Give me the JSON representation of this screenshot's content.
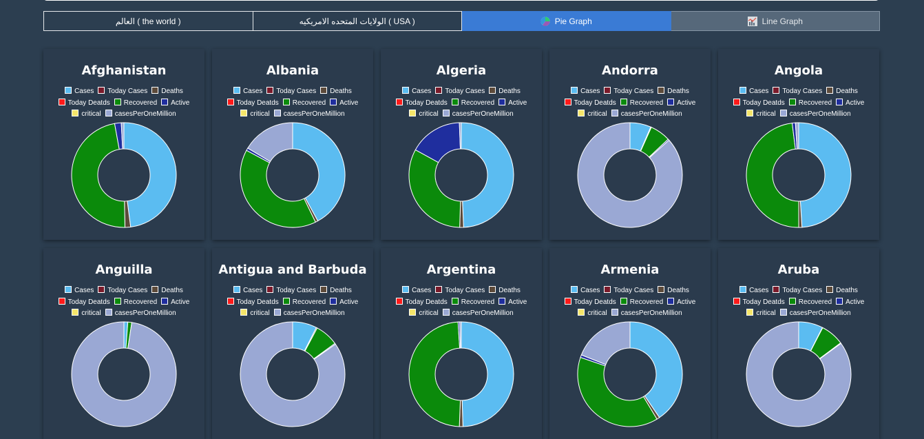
{
  "tabs": [
    {
      "label": "العالم ( the world )",
      "icon": "",
      "state": "default"
    },
    {
      "label": "الولايات المتحده الامريكيه ( USA )",
      "icon": "",
      "state": "default"
    },
    {
      "label": "Pie Graph",
      "icon": "pie-chart-icon",
      "state": "active"
    },
    {
      "label": "Line Graph",
      "icon": "line-chart-icon",
      "state": "muted"
    }
  ],
  "legend": [
    {
      "label": "Cases",
      "color": "#5bbcf1"
    },
    {
      "label": "Today Cases",
      "color": "#7a1a2a"
    },
    {
      "label": "Deaths",
      "color": "#5c4a3a"
    },
    {
      "label": "Today Deatds",
      "color": "#ff1a1a"
    },
    {
      "label": "Recovered",
      "color": "#0b8a0b"
    },
    {
      "label": "Active",
      "color": "#1f2e9e"
    },
    {
      "label": "critical",
      "color": "#f5e56a"
    },
    {
      "label": "casesPerOneMillion",
      "color": "#9aa8d4"
    }
  ],
  "chart_data": [
    {
      "type": "pie",
      "title": "Afghanistan",
      "values": [
        47,
        0,
        1.7,
        0,
        46.5,
        2,
        0,
        0.8
      ]
    },
    {
      "type": "pie",
      "title": "Albania",
      "values": [
        42,
        0,
        0.8,
        0,
        40,
        0.8,
        0,
        16.4
      ]
    },
    {
      "type": "pie",
      "title": "Algeria",
      "values": [
        49.3,
        0,
        1.2,
        0,
        32.5,
        16.4,
        0,
        0.6
      ]
    },
    {
      "type": "pie",
      "title": "Andorra",
      "values": [
        6.5,
        0,
        0.2,
        0,
        6.3,
        0.4,
        0,
        86.6
      ]
    },
    {
      "type": "pie",
      "title": "Angola",
      "values": [
        49,
        0,
        1,
        0,
        48,
        1,
        0,
        1
      ]
    },
    {
      "type": "pie",
      "title": "Anguilla",
      "values": [
        1.2,
        0,
        0,
        0,
        1.2,
        0,
        0,
        97.6
      ]
    },
    {
      "type": "pie",
      "title": "Antigua and Barbuda",
      "values": [
        7.5,
        0,
        0.3,
        0,
        7.2,
        0.3,
        0,
        84.7
      ]
    },
    {
      "type": "pie",
      "title": "Argentina",
      "values": [
        49.5,
        0,
        1.1,
        0,
        48.4,
        0.5,
        0,
        0.5
      ]
    },
    {
      "type": "pie",
      "title": "Armenia",
      "values": [
        40.5,
        0,
        0.9,
        0,
        38.8,
        0.8,
        0,
        19
      ]
    },
    {
      "type": "pie",
      "title": "Aruba",
      "values": [
        7.5,
        0,
        0.1,
        0,
        7.2,
        0.2,
        0,
        85
      ]
    }
  ]
}
